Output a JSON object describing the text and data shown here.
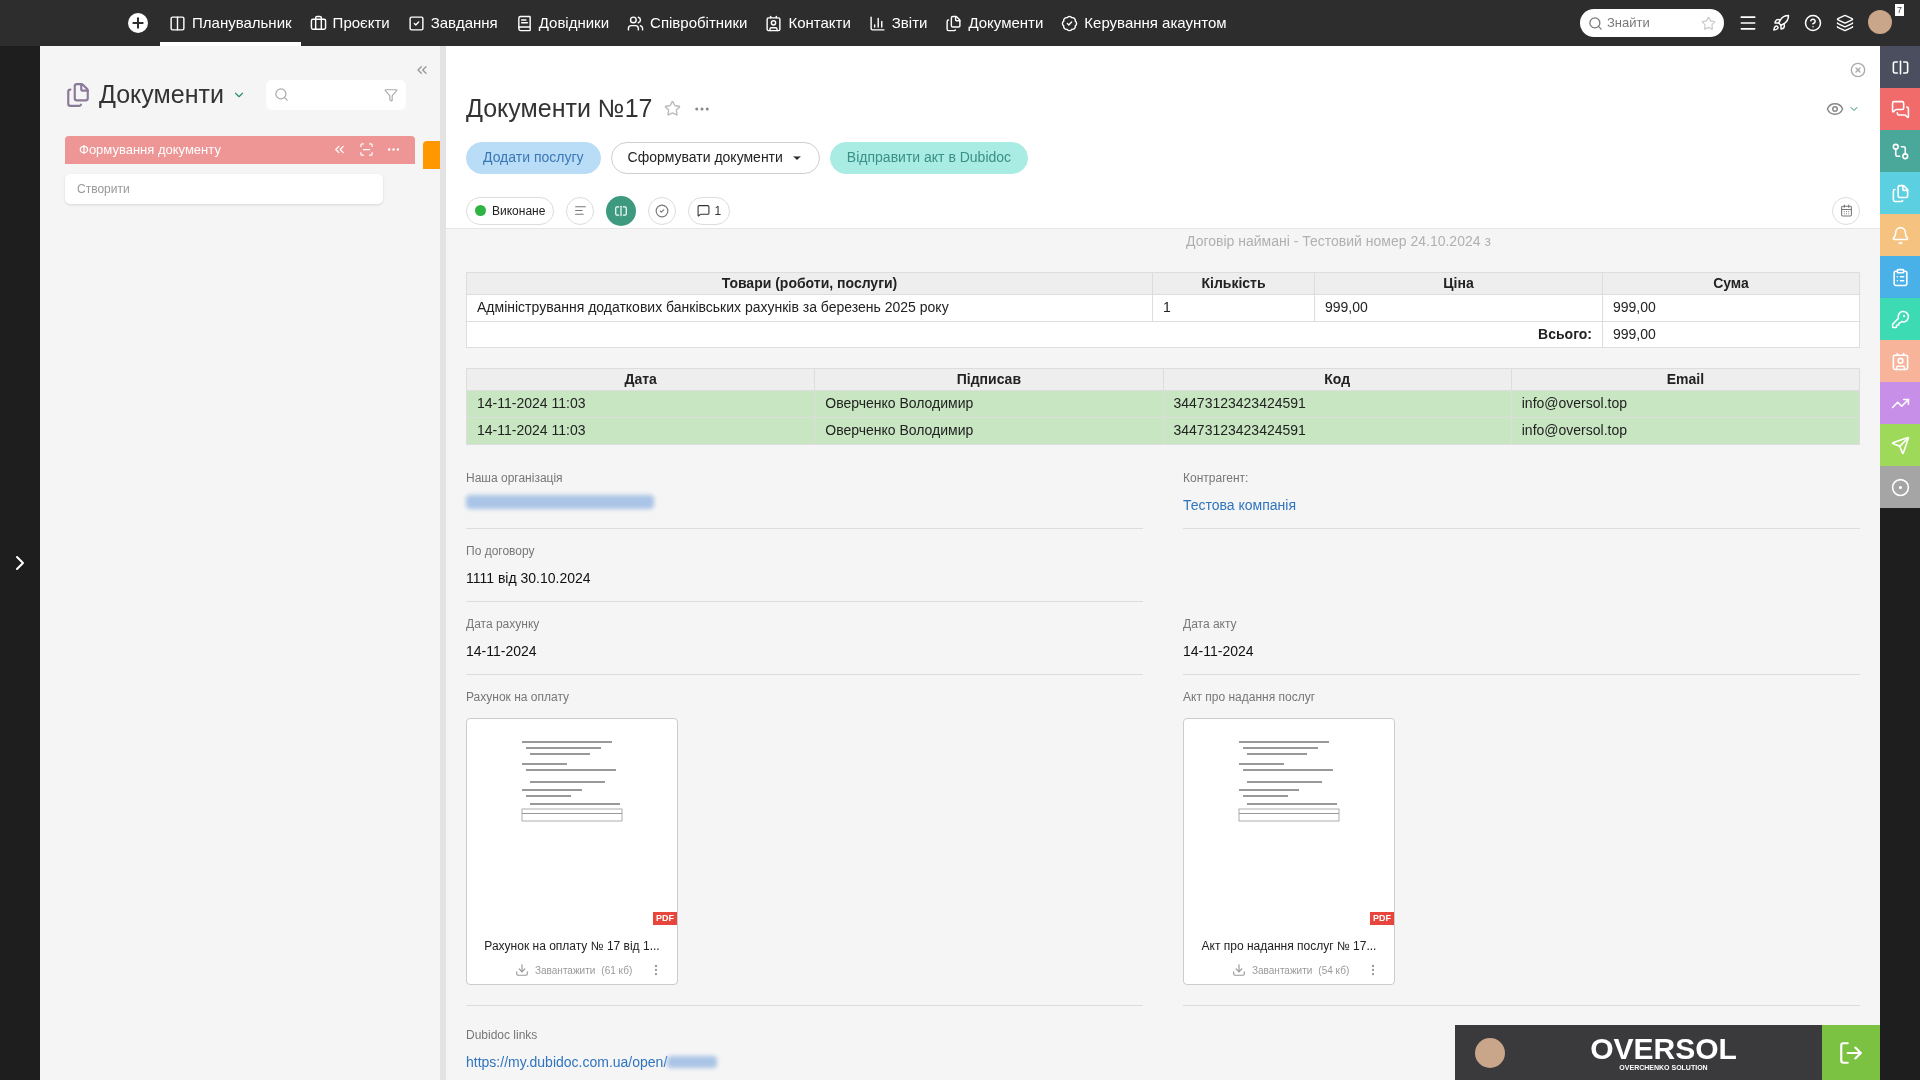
{
  "top_nav": {
    "items": [
      {
        "label": "Планувальник",
        "selected": true
      },
      {
        "label": "Проєкти",
        "selected": false
      },
      {
        "label": "Завдання",
        "selected": false
      },
      {
        "label": "Довідники",
        "selected": false
      },
      {
        "label": "Співробітники",
        "selected": false
      },
      {
        "label": "Контакти",
        "selected": false
      },
      {
        "label": "Звіти",
        "selected": false
      },
      {
        "label": "Документи",
        "selected": false
      },
      {
        "label": "Керування акаунтом",
        "selected": false
      }
    ],
    "search": {
      "placeholder": "Знайти"
    },
    "notification_count": "7"
  },
  "left_panel": {
    "title": "Документи",
    "stage": {
      "label": "Формування документу",
      "color": "#ee9595"
    },
    "create_placeholder": "Створити"
  },
  "document": {
    "title": "Документи №17",
    "actions": [
      {
        "label": "Додати послугу",
        "kind": "primary"
      },
      {
        "label": "Сформувати документи",
        "kind": "dropdown"
      },
      {
        "label": "Відправити акт в Dubidoc",
        "kind": "secondary"
      }
    ],
    "status": {
      "label": "Виконане",
      "color": "#2fb344"
    },
    "comments_count": "1",
    "linked_note": "Договір наймані - Тестовий номер 24.10.2024 з",
    "items_table": {
      "columns": [
        "Товари (роботи, послуги)",
        "Кількість",
        "Ціна",
        "Сума"
      ],
      "rows": [
        [
          "Адміністрування додаткових банківських рахунків за березень 2025 року",
          "1",
          "999,00",
          "999,00"
        ]
      ],
      "total_label": "Всього:",
      "total": "999,00"
    },
    "signatures_table": {
      "columns": [
        "Дата",
        "Підписав",
        "Код",
        "Email"
      ],
      "rows": [
        {
          "cells": [
            "14-11-2024 11:03",
            "Оверченко Володимир",
            "34473123423424591",
            "info@oversol.top"
          ],
          "signed": true
        },
        {
          "cells": [
            "14-11-2024 11:03",
            "Оверченко Володимир",
            "34473123423424591",
            "info@oversol.top"
          ],
          "signed": true
        }
      ]
    },
    "field_rows": [
      [
        {
          "label": "Наша організація",
          "kind": "redacted"
        },
        {
          "label": "Контрагент:",
          "value": "Тестова компанія",
          "kind": "link"
        }
      ],
      [
        {
          "label": "По договору",
          "value": "1111 від 30.10.2024",
          "kind": "text"
        }
      ],
      [
        {
          "label": "Дата рахунку",
          "value": "14-11-2024",
          "kind": "text"
        },
        {
          "label": "Дата акту",
          "value": "14-11-2024",
          "kind": "text"
        }
      ]
    ],
    "files": [
      {
        "section_label": "Рахунок на оплату",
        "name": "Рахунок на оплату № 17 від 1...",
        "download_label": "Завантажити",
        "size": "(61 кб)",
        "badge": "PDF"
      },
      {
        "section_label": "Акт про надання послуг",
        "name": "Акт про надання послуг № 17...",
        "download_label": "Завантажити",
        "size": "(54 кб)",
        "badge": "PDF"
      }
    ],
    "links_label": "Dubidoc links",
    "link": "https://my.dubidoc.com.ua/open/"
  },
  "banner": {
    "brand": "OVERSOL",
    "tagline": "OVERCHENKO SOLUTION"
  }
}
